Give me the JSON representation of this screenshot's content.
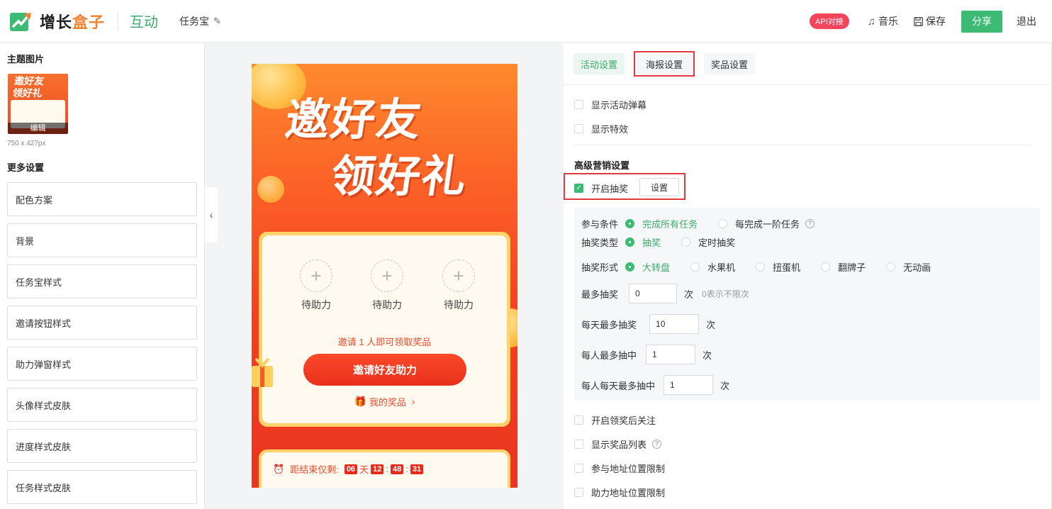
{
  "header": {
    "logo_part1": "增长",
    "logo_part2": "盒子",
    "module": "互动",
    "task_name": "任务宝",
    "api_badge": "API对接",
    "music": "音乐",
    "save": "保存",
    "share": "分享",
    "exit": "退出"
  },
  "left": {
    "theme_title": "主题图片",
    "thumb_line1": "邀好友",
    "thumb_line2": "领好礼",
    "edit_label": "编辑",
    "image_size": "750 x 427px",
    "more_title": "更多设置",
    "items": [
      "配色方案",
      "背景",
      "任务宝样式",
      "邀请按钮样式",
      "助力弹窗样式",
      "头像样式皮肤",
      "进度样式皮肤",
      "任务样式皮肤"
    ]
  },
  "preview": {
    "headline1": "邀好友",
    "headline2": "领好礼",
    "helpers": [
      "待助力",
      "待助力",
      "待助力"
    ],
    "invite_text": "邀请 1 人即可领取奖品",
    "invite_button": "邀请好友助力",
    "my_prize": "我的奖品",
    "timer_label": "距结束仅剩:",
    "days": "06",
    "day_unit": "天",
    "hours": "12",
    "minutes": "48",
    "seconds": "31"
  },
  "right": {
    "tabs": [
      "活动设置",
      "海报设置",
      "奖品设置"
    ],
    "show_danmu": "显示活动弹幕",
    "show_effect": "显示特效",
    "adv_title": "高级营销设置",
    "lottery": "开启抽奖",
    "lottery_set": "设置",
    "cond_label": "参与条件",
    "cond_opts": [
      "完成所有任务",
      "每完成一阶任务"
    ],
    "type_label": "抽奖类型",
    "type_opts": [
      "抽奖",
      "定时抽奖"
    ],
    "form_label": "抽奖形式",
    "form_opts": [
      "大转盘",
      "水果机",
      "扭蛋机",
      "翻牌子",
      "无动画"
    ],
    "max_label": "最多抽奖",
    "max_value": "0",
    "max_hint": "0表示不限次",
    "daily_label": "每天最多抽奖",
    "daily_value": "10",
    "per_label": "每人最多抽中",
    "per_value": "1",
    "per_daily_label": "每人每天最多抽中",
    "per_daily_value": "1",
    "unit": "次",
    "follow_after": "开启领奖后关注",
    "show_prize_list": "显示奖品列表",
    "join_location": "参与地址位置限制",
    "help_location": "助力地址位置限制"
  },
  "colors": {
    "brand_green": "#3dbb74",
    "logo_orange": "#f0822e",
    "highlight_red": "#e0393e",
    "api_badge": "#f5455a"
  }
}
